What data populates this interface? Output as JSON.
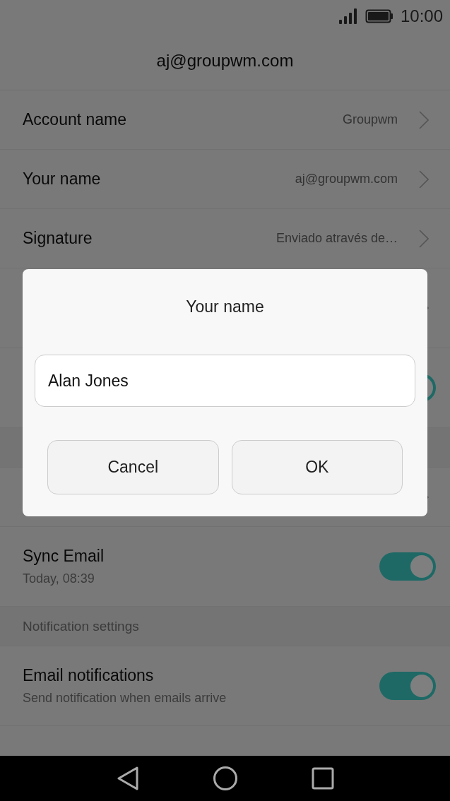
{
  "status_bar": {
    "time": "10:00"
  },
  "header": {
    "title": "aj@groupwm.com"
  },
  "rows": [
    {
      "kind": "link",
      "label": "Account name",
      "value": "Groupwm"
    },
    {
      "kind": "link",
      "label": "Your name",
      "value": "aj@groupwm.com"
    },
    {
      "kind": "link",
      "label": "Signature",
      "value": "Enviado através de…"
    },
    {
      "kind": "detail"
    },
    {
      "kind": "toggle",
      "on": true
    },
    {
      "kind": "section"
    },
    {
      "kind": "link"
    },
    {
      "kind": "toggle",
      "label": "Sync Email",
      "subtitle": "Today, 08:39",
      "on": true
    },
    {
      "kind": "section",
      "label": "Notification settings"
    },
    {
      "kind": "toggle",
      "label": "Email notifications",
      "subtitle": "Send notification when emails arrive",
      "on": true
    }
  ],
  "dialog": {
    "title": "Your name",
    "value": "Alan Jones",
    "buttons": [
      "Cancel",
      "OK"
    ]
  }
}
